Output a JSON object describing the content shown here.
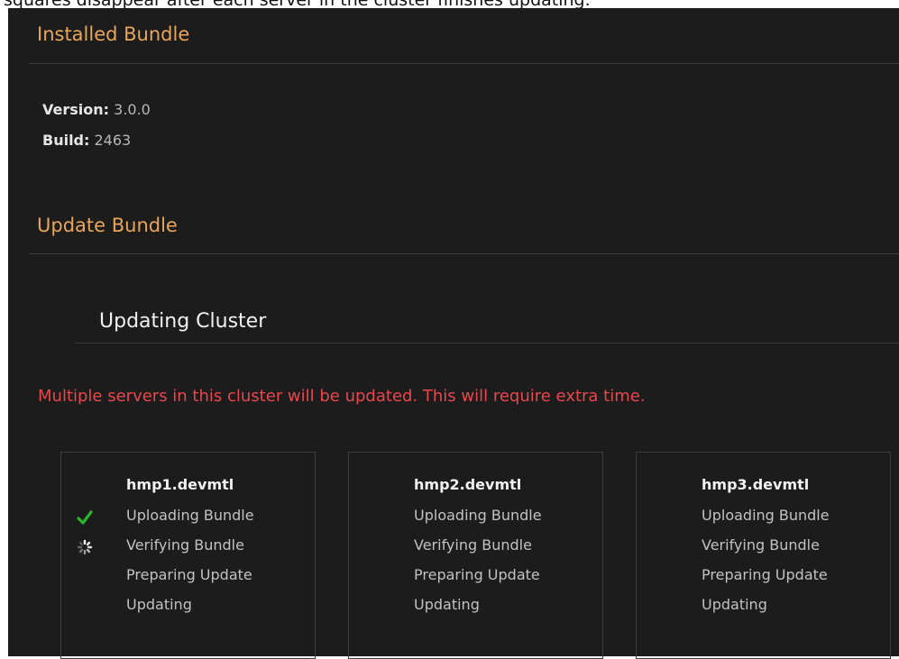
{
  "caption": "squares disappear after each server in the cluster finishes updating.",
  "installed": {
    "title": "Installed Bundle",
    "version_label": "Version:",
    "version_value": "3.0.0",
    "build_label": "Build:",
    "build_value": "2463"
  },
  "update": {
    "title": "Update Bundle",
    "cluster_title": "Updating Cluster",
    "warning": "Multiple servers in this cluster will be updated. This will require extra time."
  },
  "servers": [
    {
      "name": "hmp1.devmtl",
      "steps": [
        "Uploading Bundle",
        "Verifying Bundle",
        "Preparing Update",
        "Updating"
      ],
      "step_states": [
        "done",
        "in-progress",
        "pending",
        "pending"
      ]
    },
    {
      "name": "hmp2.devmtl",
      "steps": [
        "Uploading Bundle",
        "Verifying Bundle",
        "Preparing Update",
        "Updating"
      ],
      "step_states": [
        "pending",
        "pending",
        "pending",
        "pending"
      ]
    },
    {
      "name": "hmp3.devmtl",
      "steps": [
        "Uploading Bundle",
        "Verifying Bundle",
        "Preparing Update",
        "Updating"
      ],
      "step_states": [
        "pending",
        "pending",
        "pending",
        "pending"
      ]
    }
  ],
  "colors": {
    "background": "#1c1c1c",
    "section_title": "#e8a55a",
    "warning": "#e8474c",
    "check": "#2bb52b"
  }
}
